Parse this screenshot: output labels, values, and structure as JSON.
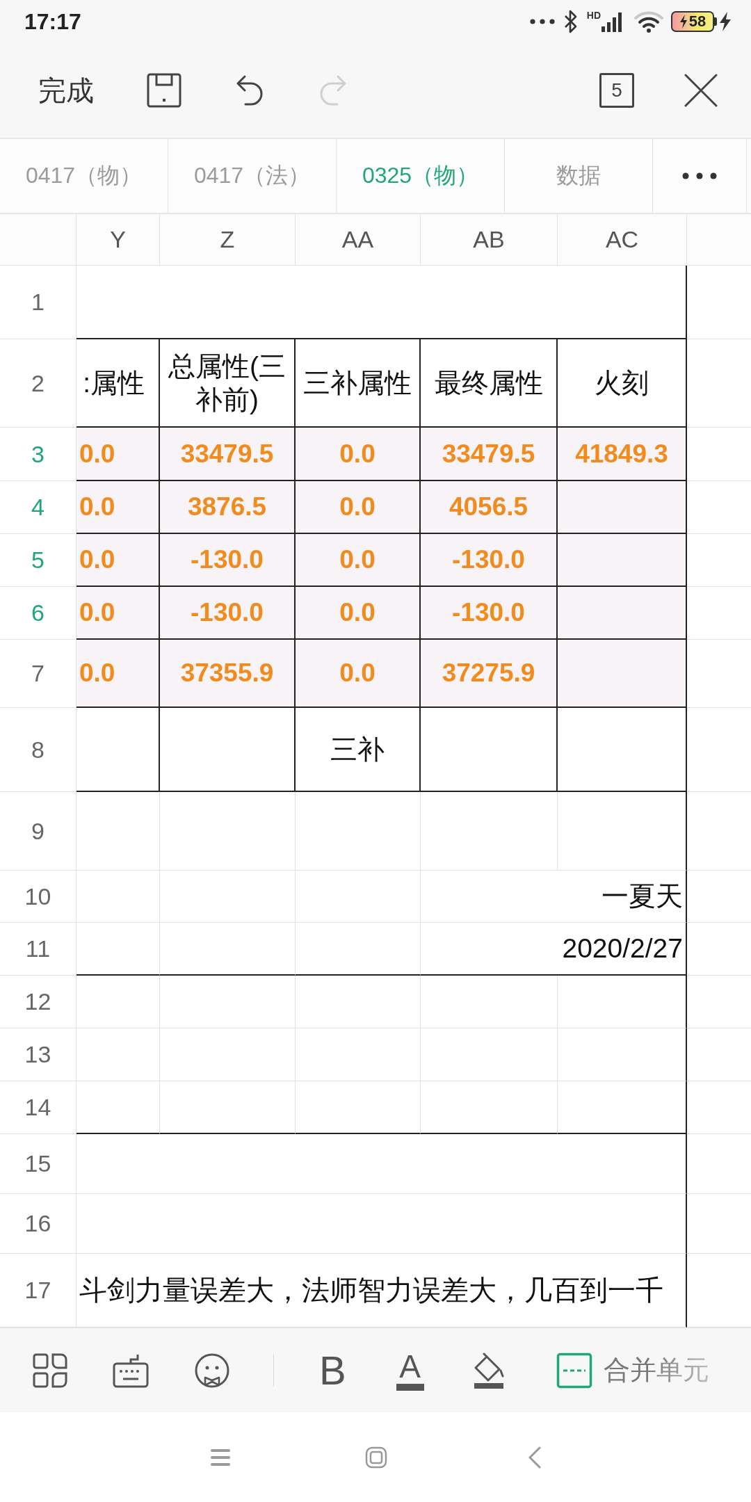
{
  "status_bar": {
    "time": "17:17",
    "network_label": "HD",
    "battery_percent": "58",
    "charging": true
  },
  "toolbar": {
    "done_label": "完成",
    "window_count": "5",
    "undo": {
      "disabled": false
    },
    "redo": {
      "disabled": true
    }
  },
  "sheet_tabs": [
    {
      "label": "0417（物）",
      "selected": false
    },
    {
      "label": "0417（法）",
      "selected": false
    },
    {
      "label": "0325（物）",
      "selected": true
    },
    {
      "label": "数据",
      "selected": false
    }
  ],
  "grid": {
    "columns": [
      "Y",
      "Z",
      "AA",
      "AB",
      "AC"
    ],
    "rows": [
      {
        "number": "1",
        "selected": false,
        "kind": "blank",
        "rule_below": true,
        "cells": [
          {}
        ]
      },
      {
        "number": "2",
        "selected": false,
        "kind": "header",
        "rule_below": true,
        "cells": [
          {
            "text": ":属性"
          },
          {
            "text": "总属性(三补前)"
          },
          {
            "text": "三补属性"
          },
          {
            "text": "最终属性"
          },
          {
            "text": "火刻"
          }
        ]
      },
      {
        "number": "3",
        "selected": true,
        "kind": "value",
        "rule_below": true,
        "cells": [
          {
            "text": "0.0"
          },
          {
            "text": "33479.5"
          },
          {
            "text": "0.0"
          },
          {
            "text": "33479.5"
          },
          {
            "text": "41849.3"
          }
        ]
      },
      {
        "number": "4",
        "selected": true,
        "kind": "value",
        "rule_below": true,
        "cells": [
          {
            "text": "0.0"
          },
          {
            "text": "3876.5"
          },
          {
            "text": "0.0"
          },
          {
            "text": "4056.5"
          },
          {}
        ]
      },
      {
        "number": "5",
        "selected": true,
        "kind": "value",
        "rule_below": true,
        "cells": [
          {
            "text": "0.0"
          },
          {
            "text": "-130.0"
          },
          {
            "text": "0.0"
          },
          {
            "text": "-130.0"
          },
          {}
        ]
      },
      {
        "number": "6",
        "selected": true,
        "kind": "value",
        "rule_below": true,
        "cells": [
          {
            "text": "0.0"
          },
          {
            "text": "-130.0"
          },
          {
            "text": "0.0"
          },
          {
            "text": "-130.0"
          },
          {}
        ]
      },
      {
        "number": "7",
        "selected": false,
        "kind": "value",
        "rule_below": true,
        "cells": [
          {
            "text": "0.0"
          },
          {
            "text": "37355.9"
          },
          {
            "text": "0.0"
          },
          {
            "text": "37275.9"
          },
          {}
        ]
      },
      {
        "number": "8",
        "selected": false,
        "kind": "label",
        "rule_below": true,
        "cells": [
          {},
          {},
          {
            "text": "三补"
          },
          {},
          {}
        ]
      },
      {
        "number": "9",
        "selected": false,
        "kind": "blank",
        "rule_below": false,
        "cells": [
          {},
          {},
          {},
          {},
          {}
        ]
      },
      {
        "number": "10",
        "selected": false,
        "kind": "signer",
        "rule_below": false,
        "cells": [
          {},
          {},
          {},
          {
            "text": "一夏天"
          }
        ]
      },
      {
        "number": "11",
        "selected": false,
        "kind": "date",
        "rule_below": true,
        "cells": [
          {},
          {},
          {},
          {
            "text": "2020/2/27"
          }
        ]
      },
      {
        "number": "12",
        "selected": false,
        "kind": "blank",
        "rule_below": false,
        "cells": [
          {},
          {},
          {},
          {},
          {}
        ]
      },
      {
        "number": "13",
        "selected": false,
        "kind": "blank",
        "rule_below": false,
        "cells": [
          {},
          {},
          {},
          {},
          {}
        ]
      },
      {
        "number": "14",
        "selected": false,
        "kind": "blank",
        "rule_below": true,
        "cells": [
          {},
          {},
          {},
          {},
          {}
        ]
      },
      {
        "number": "15",
        "selected": false,
        "kind": "blank",
        "rule_below": false,
        "cells": [
          {}
        ]
      },
      {
        "number": "16",
        "selected": false,
        "kind": "blank",
        "rule_below": false,
        "cells": [
          {}
        ]
      },
      {
        "number": "17",
        "selected": false,
        "kind": "note",
        "rule_below": false,
        "cells": [
          {
            "text": "斗剑力量误差大，法师智力误差大，几百到一千"
          }
        ]
      }
    ]
  },
  "format_bar": {
    "bold_label": "B",
    "font_color_label": "A",
    "merge_label": "合并单元"
  }
}
